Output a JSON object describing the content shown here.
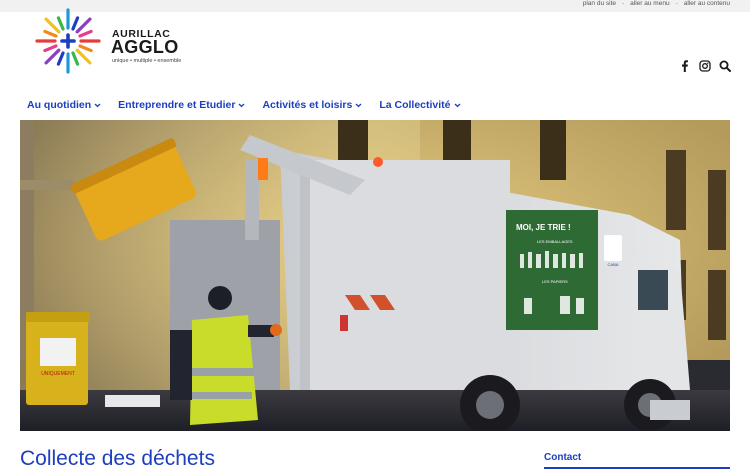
{
  "topbar": {
    "links": [
      {
        "label": "plan du site"
      },
      {
        "label": "aller au menu"
      },
      {
        "label": "aller au contenu"
      }
    ],
    "separator": "-"
  },
  "logo": {
    "line1": "AURILLAC",
    "line2": "AGGLO",
    "tagline": "unique • multiple • ensemble"
  },
  "social": {
    "icons": [
      "facebook-icon",
      "instagram-icon",
      "search-icon"
    ]
  },
  "nav": {
    "items": [
      {
        "label": "Au quotidien"
      },
      {
        "label": "Entreprendre et Etudier"
      },
      {
        "label": "Activités et loisirs"
      },
      {
        "label": "La Collectivité"
      }
    ]
  },
  "hero": {
    "truck_panel_title": "MOI, JE TRIE !",
    "truck_panel_line1": "LES EMBALLAGES",
    "truck_panel_line2": "LES PAPIERS",
    "truck_logo": "CABA",
    "bin_sign": "UNIQUEMENT"
  },
  "page": {
    "title": "Collecte des déchets"
  },
  "contact": {
    "label": "Contact"
  },
  "colors": {
    "brand_blue": "#1d3fbf",
    "topbar_bg": "#f1f1f1"
  }
}
